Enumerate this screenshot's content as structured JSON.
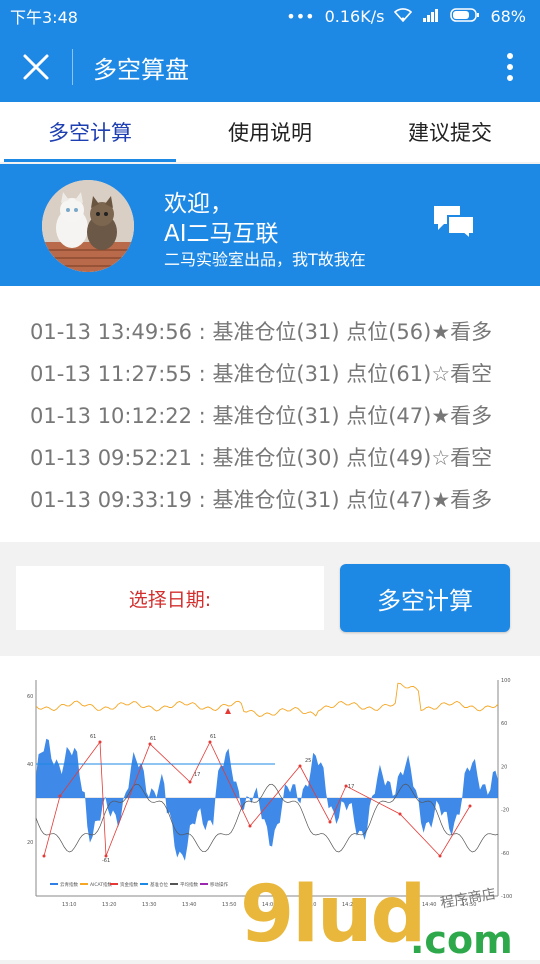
{
  "status_bar": {
    "time": "下午3:48",
    "network_speed": "0.16K/s",
    "battery": "68%"
  },
  "titlebar": {
    "title": "多空算盘"
  },
  "tabs": [
    {
      "label": "多空计算",
      "active": true
    },
    {
      "label": "使用说明",
      "active": false
    },
    {
      "label": "建议提交",
      "active": false
    }
  ],
  "banner": {
    "greeting": "欢迎，",
    "username": "AI二马互联",
    "subtitle": "二马实验室出品，我T故我在"
  },
  "records": [
    "01-13 13:49:56 : 基准仓位(31) 点位(56)★看多",
    "01-13 11:27:55 : 基准仓位(31) 点位(61)☆看空",
    "01-13 10:12:22 : 基准仓位(31) 点位(47)★看多",
    "01-13 09:52:21 : 基准仓位(30) 点位(49)☆看空",
    "01-13 09:33:19 : 基准仓位(31) 点位(47)★看多"
  ],
  "controls": {
    "date_label": "选择日期:",
    "calc_button": "多空计算"
  },
  "chart_data": {
    "type": "area",
    "x_ticks": [
      "13:10",
      "13:20",
      "13:30",
      "13:40",
      "13:50",
      "14:00",
      "14:10",
      "14:20",
      "14:30",
      "14:40",
      "14:50"
    ],
    "y_left_ticks": [
      "60",
      "40",
      "20"
    ],
    "y_right_ticks": [
      "100",
      "60",
      "20",
      "-20",
      "-60",
      "-100"
    ],
    "point_labels": [
      "61",
      "61",
      "61",
      "25",
      "17",
      "17",
      "-61"
    ],
    "legend": [
      "云青指数",
      "AICAT指数",
      "资金指数",
      "基准仓位",
      "平均指数",
      "移动操作"
    ],
    "colors": {
      "area": "#2f7fe6",
      "orange_line": "#f5a623",
      "red_line": "#e53935",
      "gray_line": "#555555",
      "blue_line": "#1e88e5"
    }
  },
  "watermark": {
    "main": "9lud",
    "domain": ".com",
    "tagline": "程序商店"
  }
}
